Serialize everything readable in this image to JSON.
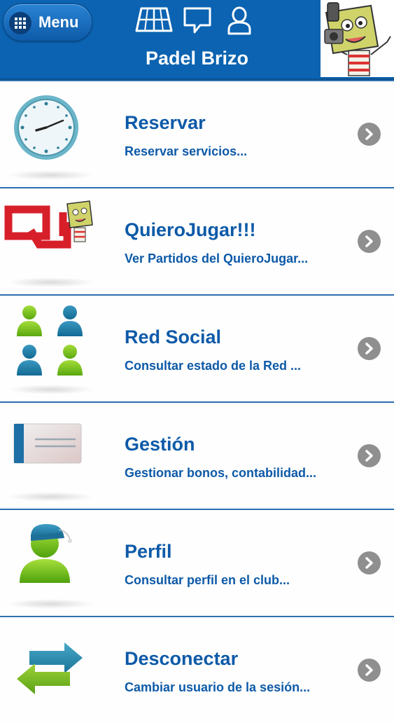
{
  "header": {
    "menu_label": "Menu",
    "title": "Padel Brizo",
    "icons": [
      "court-icon",
      "chat-icon",
      "user-icon"
    ],
    "avatar": "mascot-avatar",
    "colors": {
      "bar": "#0b63b1",
      "text": "#ffffff"
    }
  },
  "items": [
    {
      "title": "Reservar",
      "subtitle": "Reservar servicios...",
      "icon": "clock-icon"
    },
    {
      "title": "QuieroJugar!!!",
      "subtitle": "Ver Partidos del QuieroJugar...",
      "icon": "quierojugar-logo-icon"
    },
    {
      "title": "Red Social",
      "subtitle": "Consultar estado de la Red ...",
      "icon": "people-group-icon"
    },
    {
      "title": "Gestión",
      "subtitle": "Gestionar bonos, contabilidad...",
      "icon": "card-icon"
    },
    {
      "title": "Perfil",
      "subtitle": "Consultar perfil en el club...",
      "icon": "profile-icon"
    },
    {
      "title": "Desconectar",
      "subtitle": "Cambiar usuario de la sesión...",
      "icon": "switch-arrows-icon"
    }
  ],
  "colors": {
    "accent": "#0d5aa8",
    "divider": "#2f6fb0",
    "chevron": "#8f8f8f"
  }
}
